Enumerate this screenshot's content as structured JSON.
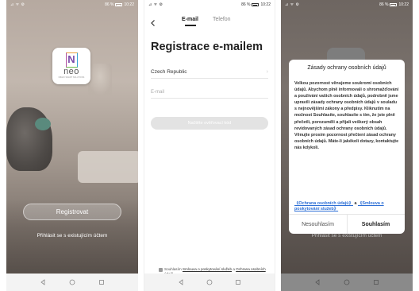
{
  "status_bar": {
    "signal": "⊿ ᯤ ⚙",
    "battery_percent": "86 %",
    "time": "10:22"
  },
  "welcome": {
    "logo_word": "neo",
    "logo_tagline": "IMMAX SMART SOLUTIONS",
    "register_label": "Registrovat",
    "login_link": "Přihlásit se s existujícím účtem"
  },
  "register": {
    "tabs": [
      "E-mail",
      "Telefon"
    ],
    "title": "Registrace e-mailem",
    "country": "Czech Republic",
    "email_placeholder": "E-mail",
    "code_button": "Načtěte ověřovací kód",
    "agree_prefix": "Souhlasím ",
    "agree_link1": "Smlouva o poskytování služeb",
    "agree_mid": " a ",
    "agree_link2": "Ochrana osobních údajů"
  },
  "privacy_dialog": {
    "title": "Zásady ochrany osobních údajů",
    "body": "Velkou pozornost věnujeme soukromí osobních údajů. Abychom plně informovali o shromažďování a používání vašich osobních údajů, podrobně jsme upravili zásady ochrany osobních údajů v souladu s nejnovějšími zákony a předpisy. Kliknutím na možnost Souhlasíte, souhlasíte s tím, že jste plně přečetli, porozuměli a přijali veškerý obsah revidovaných zásad ochrany osobních údajů. Věnujte prosím pozornost přečtení zásad ochrany osobních údajů. Máte-li jakékoli dotazy, kontaktujte nás kdykoli.",
    "link1": "《Ochrana osobních údajů》",
    "link_mid": " a ",
    "link2": "《Smlouva o poskytování služeb》",
    "decline_label": "Nesouhlasím",
    "accept_label": "Souhlasím",
    "behind_login": "Přihlásit se s existujícím účtem"
  },
  "icons": {
    "back": "chevron-left-icon",
    "nav_back": "triangle-back-icon",
    "nav_home": "circle-home-icon",
    "nav_recent": "square-recent-icon"
  },
  "colors": {
    "link": "#2d6fd6",
    "logo_purple": "#7a4aa8"
  }
}
